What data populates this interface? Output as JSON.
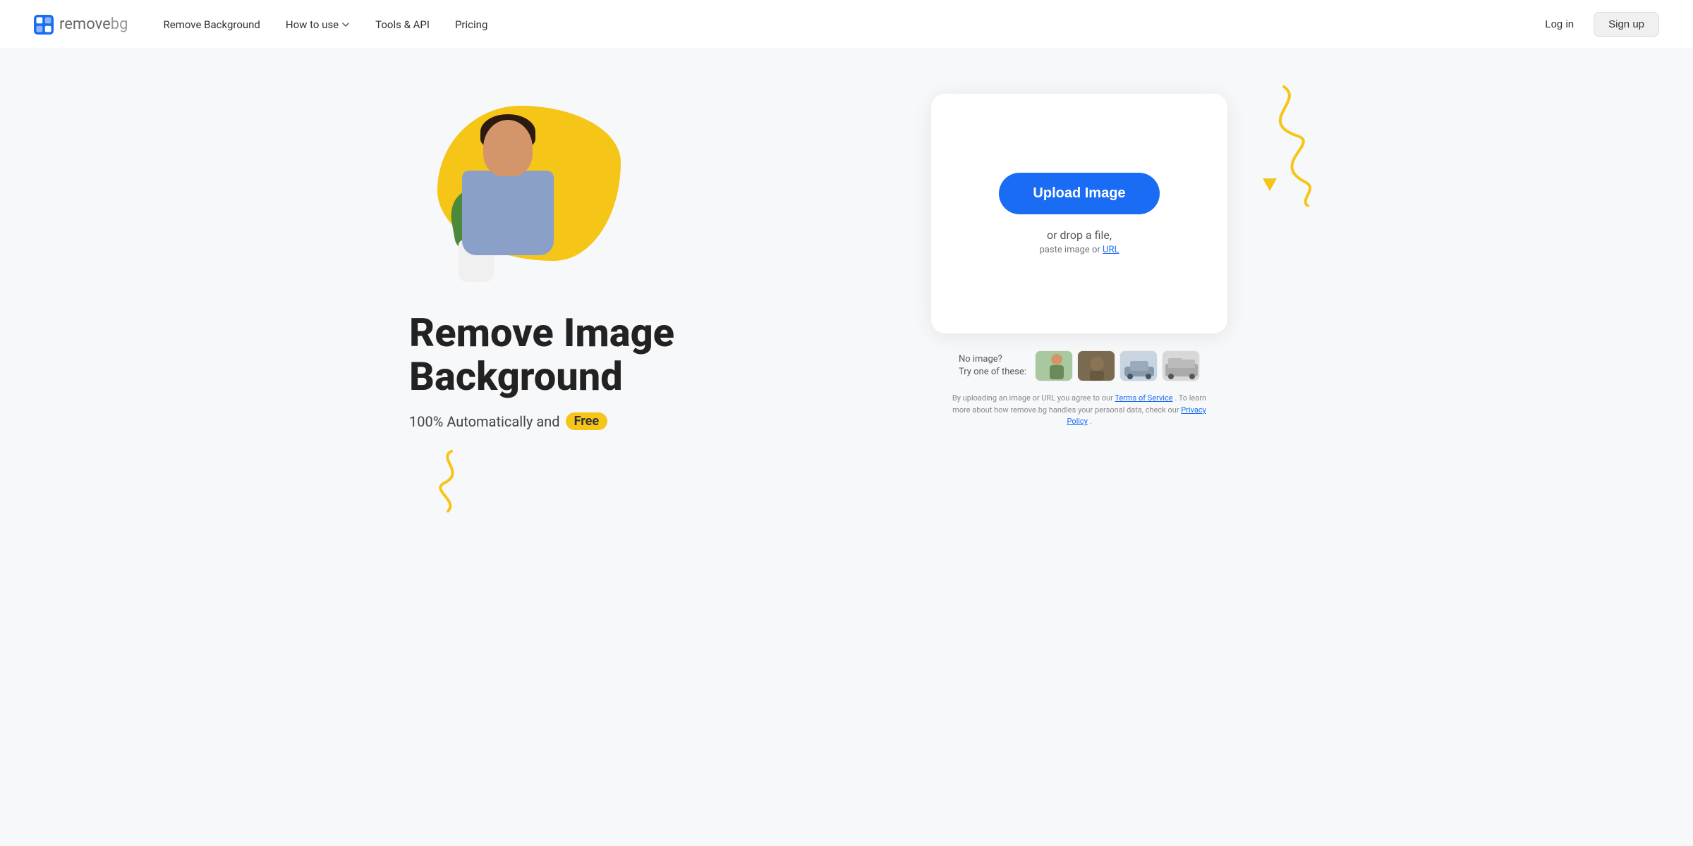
{
  "brand": {
    "name_part1": "remove",
    "name_part2": "bg",
    "logo_alt": "remove.bg logo"
  },
  "nav": {
    "links": [
      {
        "id": "remove-background",
        "label": "Remove Background",
        "has_dropdown": false
      },
      {
        "id": "how-to-use",
        "label": "How to use",
        "has_dropdown": true
      },
      {
        "id": "tools-api",
        "label": "Tools & API",
        "has_dropdown": false
      },
      {
        "id": "pricing",
        "label": "Pricing",
        "has_dropdown": false
      }
    ],
    "login_label": "Log in",
    "signup_label": "Sign up"
  },
  "hero": {
    "title_line1": "Remove Image",
    "title_line2": "Background",
    "subtitle_prefix": "100% Automatically and",
    "badge": "Free"
  },
  "upload": {
    "button_label": "Upload Image",
    "drop_text": "or drop a file,",
    "paste_text": "paste image or",
    "url_label": "URL",
    "no_image_label": "No image?",
    "try_label": "Try one of these:",
    "tos_text": "By uploading an image or URL you agree to our",
    "tos_link": "Terms of Service",
    "tos_middle": ". To learn more about how remove.bg handles your personal data, check our",
    "privacy_link": "Privacy Policy",
    "tos_end": "."
  },
  "colors": {
    "accent_blue": "#1a6cf5",
    "accent_yellow": "#f5c518",
    "text_dark": "#222222",
    "text_mid": "#444444",
    "text_light": "#888888"
  }
}
